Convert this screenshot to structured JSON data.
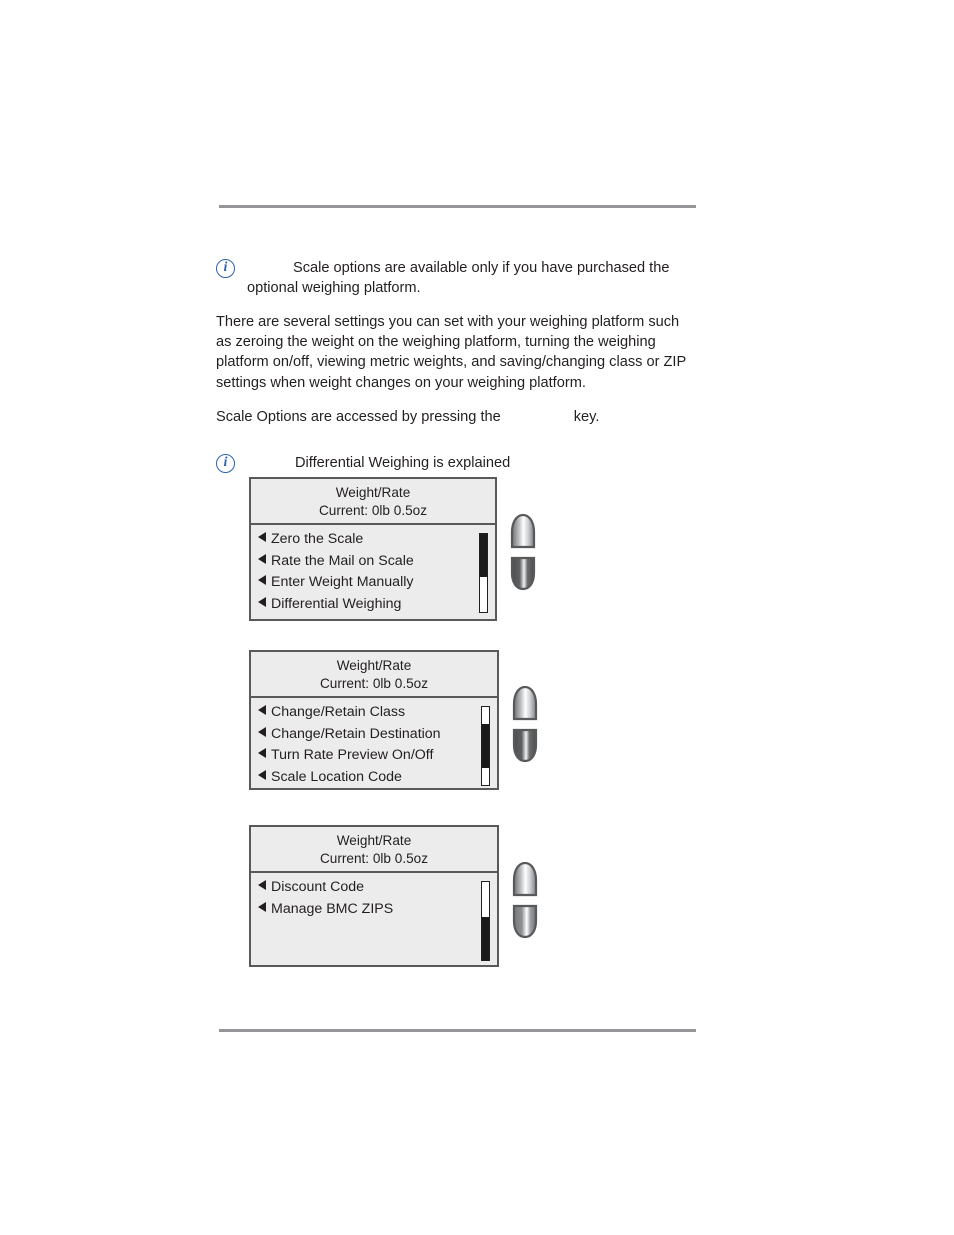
{
  "document": {
    "notes": [
      {
        "icon": "info-icon",
        "text": "        Scale options are available only if you have purchased the optional weighing platform."
      },
      {
        "icon": "info-icon",
        "text": "         Differential Weighing is explained"
      }
    ],
    "paragraphs": [
      "There are several settings you can set with your weighing platform such as zeroing the weight on the weighing platform, turning the weighing platform on/off, viewing metric weights, and saving/changing class or ZIP settings when weight changes on your weighing platform."
    ],
    "key_line": {
      "before": "Scale Options are accessed by pressing the",
      "gap": "                  ",
      "after": "key."
    }
  },
  "screens": [
    {
      "title": "Weight/Rate",
      "subtitle": "Current:  0lb 0.5oz",
      "items": [
        "Zero the Scale",
        "Rate the Mail on Scale",
        "Enter Weight Manually",
        "Differential Weighing"
      ],
      "scrollbar": {
        "position": "top",
        "thumb_top_pct": 0,
        "thumb_height_pct": 55
      },
      "keys": {
        "up": "scroll-up-key",
        "down": "scroll-down-key"
      }
    },
    {
      "title": "Weight/Rate",
      "subtitle": "Current:  0lb 0.5oz",
      "items": [
        "Change/Retain Class",
        "Change/Retain Destination",
        "Turn Rate Preview On/Off",
        "Scale Location Code"
      ],
      "scrollbar": {
        "position": "middle",
        "thumb_top_pct": 22,
        "thumb_height_pct": 56
      },
      "keys": {
        "up": "scroll-up-key",
        "down": "scroll-down-key"
      }
    },
    {
      "title": "Weight/Rate",
      "subtitle": "Current:  0lb 0.5oz",
      "items": [
        "Discount Code",
        "Manage BMC ZIPS"
      ],
      "scrollbar": {
        "position": "bottom",
        "thumb_top_pct": 45,
        "thumb_height_pct": 55
      },
      "keys": {
        "up": "scroll-up-key",
        "down": "scroll-down-key"
      }
    }
  ],
  "colors": {
    "rule": "#939598",
    "lcd_background": "#ececec",
    "lcd_border": "#58595b",
    "info_icon": "#2b62ae",
    "scroll_thumb": "#1a1a1a",
    "text": "#231f20"
  }
}
